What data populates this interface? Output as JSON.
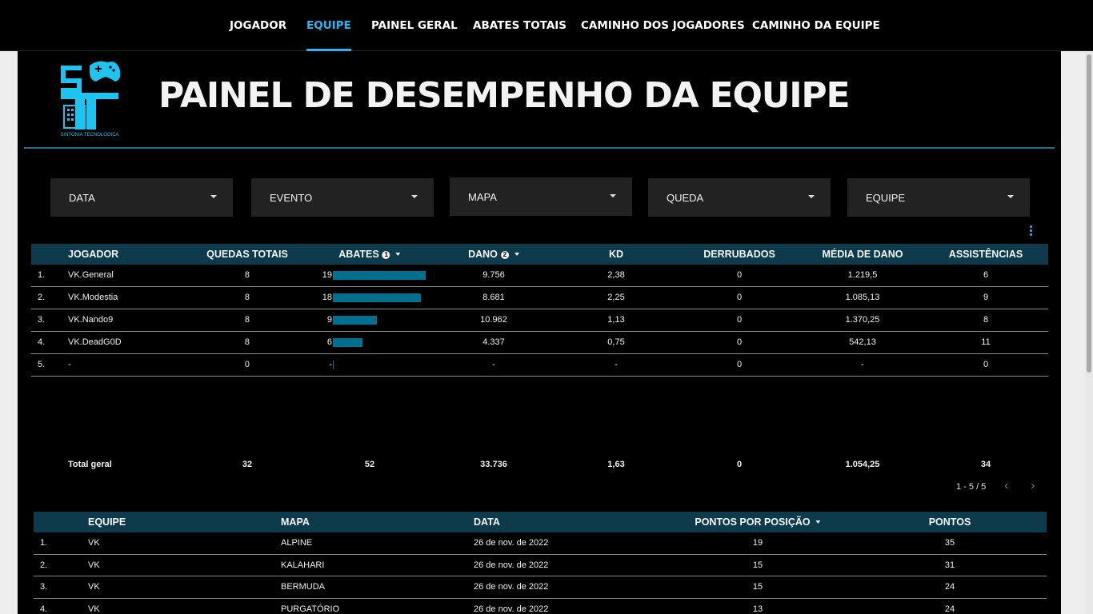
{
  "nav": {
    "tabs": [
      {
        "label": "JOGADOR",
        "active": false
      },
      {
        "label": "EQUIPE",
        "active": true
      },
      {
        "label": "PAINEL GERAL",
        "active": false
      },
      {
        "label": "ABATES TOTAIS",
        "active": false
      },
      {
        "label": "CAMINHO DOS JOGADORES",
        "active": false
      },
      {
        "label": "CAMINHO DA EQUIPE",
        "active": false
      }
    ]
  },
  "logo": {
    "letters": "ST",
    "caption": "SINTONIA TECNOLÓGICA"
  },
  "page_title": "PAINEL DE DESEMPENHO DA EQUIPE",
  "filters": [
    "DATA",
    "EVENTO",
    "MAPA",
    "QUEDA",
    "EQUIPE"
  ],
  "player_table": {
    "headers": {
      "jogador": "JOGADOR",
      "quedas": "QUEDAS TOTAIS",
      "abates": "ABATES",
      "abates_badge": "1",
      "dano": "DANO",
      "dano_badge": "2",
      "kd": "KD",
      "derrubados": "DERRUBADOS",
      "media": "MÉDIA DE DANO",
      "assist": "ASSISTÊNCIAS"
    },
    "rows": [
      {
        "idx": "1.",
        "jogador": "VK.General",
        "quedas": "8",
        "abates": "19",
        "abates_value": 19,
        "dano": "9.756",
        "kd": "2,38",
        "derrubados": "0",
        "media": "1.219,5",
        "assist": "6"
      },
      {
        "idx": "2.",
        "jogador": "VK.Modestia",
        "quedas": "8",
        "abates": "18",
        "abates_value": 18,
        "dano": "8.681",
        "kd": "2,25",
        "derrubados": "0",
        "media": "1.085,13",
        "assist": "9"
      },
      {
        "idx": "3.",
        "jogador": "VK.Nando9",
        "quedas": "8",
        "abates": "9",
        "abates_value": 9,
        "dano": "10.962",
        "kd": "1,13",
        "derrubados": "0",
        "media": "1.370,25",
        "assist": "8"
      },
      {
        "idx": "4.",
        "jogador": "VK.DeadG0D",
        "quedas": "8",
        "abates": "6",
        "abates_value": 6,
        "dano": "4.337",
        "kd": "0,75",
        "derrubados": "0",
        "media": "542,13",
        "assist": "11"
      },
      {
        "idx": "5.",
        "jogador": "-",
        "quedas": "0",
        "abates": "-",
        "abates_value": 0,
        "dano": "-",
        "kd": "-",
        "derrubados": "0",
        "media": "-",
        "assist": "0"
      }
    ],
    "abates_max": 19,
    "total": {
      "label": "Total geral",
      "quedas": "32",
      "abates": "52",
      "dano": "33.736",
      "kd": "1,63",
      "derrubados": "0",
      "media": "1.054,25",
      "assist": "34"
    },
    "pagination": "1 - 5 / 5"
  },
  "team_table": {
    "headers": {
      "equipe": "EQUIPE",
      "mapa": "MAPA",
      "data": "DATA",
      "pontos_posicao": "PONTOS POR POSIÇÃO",
      "pontos": "PONTOS"
    },
    "rows": [
      {
        "idx": "1.",
        "equipe": "VK",
        "mapa": "ALPINE",
        "data": "26 de nov. de 2022",
        "pontos_posicao": "19",
        "pontos": "35"
      },
      {
        "idx": "2.",
        "equipe": "VK",
        "mapa": "KALAHARI",
        "data": "26 de nov. de 2022",
        "pontos_posicao": "15",
        "pontos": "31"
      },
      {
        "idx": "3.",
        "equipe": "VK",
        "mapa": "BERMUDA",
        "data": "26 de nov. de 2022",
        "pontos_posicao": "15",
        "pontos": "24"
      },
      {
        "idx": "4.",
        "equipe": "VK",
        "mapa": "PURGATÓRIO",
        "data": "26 de nov. de 2022",
        "pontos_posicao": "13",
        "pontos": "24"
      }
    ]
  },
  "colors": {
    "accent": "#29b6f6",
    "header_bg": "#0d3b4b",
    "bar": "#00708e",
    "filter_bg": "#222222"
  }
}
